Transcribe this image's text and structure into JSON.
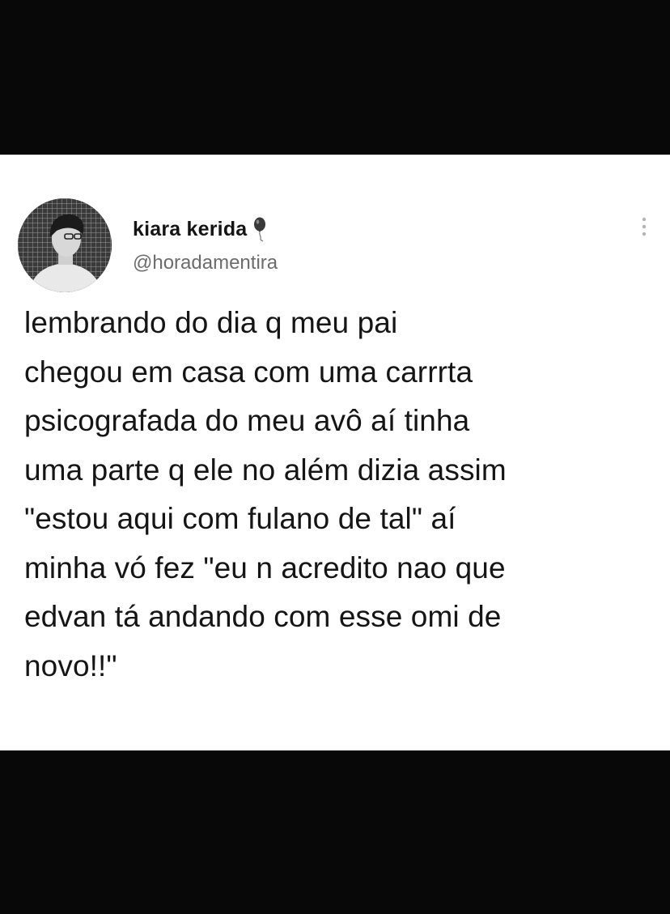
{
  "tweet": {
    "author": {
      "display_name": "kiara kerida",
      "handle": "@horadamentira",
      "name_emoji": "balloon-icon"
    },
    "text": "lembrando do dia q meu pai\nchegou em casa com uma carrrta\npsicografada do meu avô aí tinha\numa parte q ele no além dizia assim\n\"estou aqui com fulano de tal\" aí\nminha vó fez \"eu n acredito nao que\nedvan tá andando com esse omi de\nnovo!!\""
  },
  "colors": {
    "background": "#080808",
    "card": "#ffffff",
    "text": "#151515",
    "handle": "#6c6c6c"
  }
}
